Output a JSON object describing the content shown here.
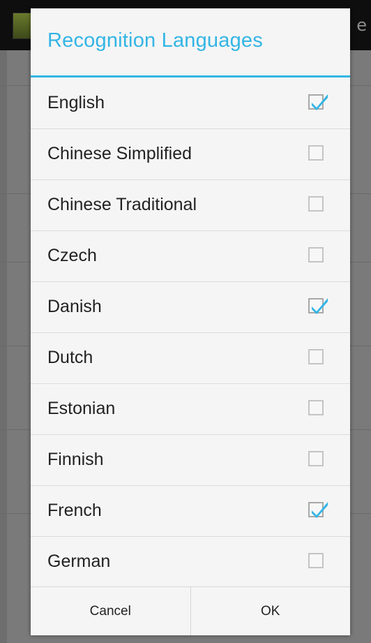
{
  "background_app": {
    "title_fragment": "e"
  },
  "dialog": {
    "title": "Recognition Languages",
    "accent_color": "#33b5e5",
    "items": [
      {
        "label": "English",
        "checked": true
      },
      {
        "label": "Chinese Simplified",
        "checked": false
      },
      {
        "label": "Chinese Traditional",
        "checked": false
      },
      {
        "label": "Czech",
        "checked": false
      },
      {
        "label": "Danish",
        "checked": true
      },
      {
        "label": "Dutch",
        "checked": false
      },
      {
        "label": "Estonian",
        "checked": false
      },
      {
        "label": "Finnish",
        "checked": false
      },
      {
        "label": "French",
        "checked": true
      },
      {
        "label": "German",
        "checked": false
      }
    ],
    "buttons": {
      "cancel": "Cancel",
      "ok": "OK"
    }
  }
}
